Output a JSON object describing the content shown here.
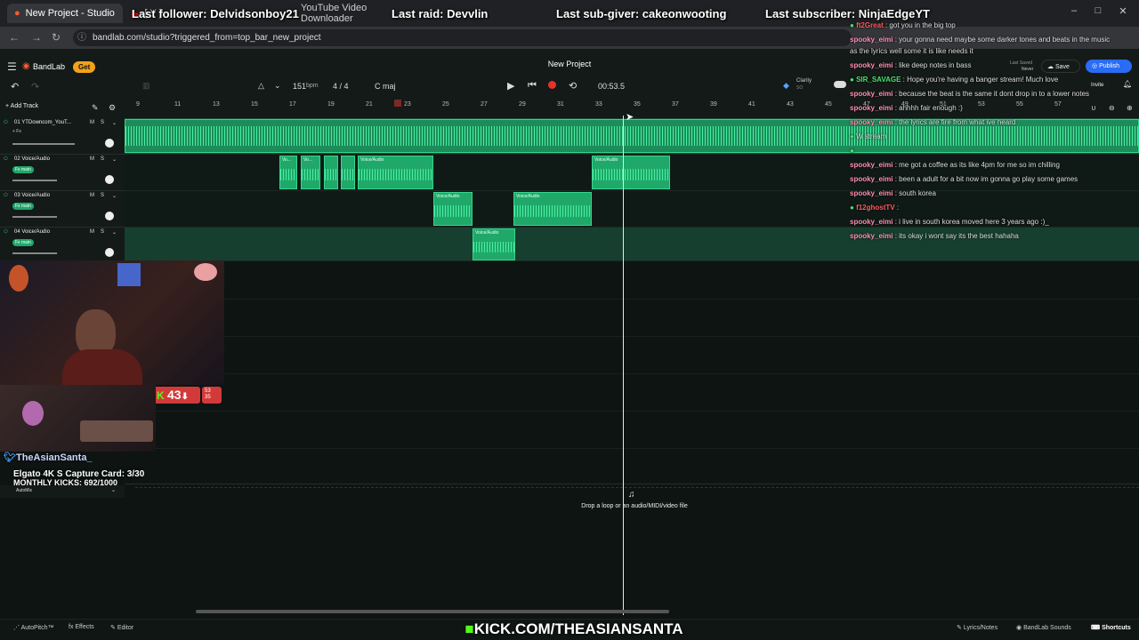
{
  "browser": {
    "tabs": [
      {
        "label": "New Project - Studio",
        "active": true
      },
      {
        "label": "[ Y ] "
      },
      {
        "label": "YouTube Video Downloader"
      }
    ],
    "url": "bandlab.com/studio?triggered_from=top_bar_new_project"
  },
  "overlay": {
    "last_follower": "Last follower: Delvidsonboy21",
    "last_raid": "Last raid: Devvlin",
    "last_subgiver": "Last sub-giver: cakeonwooting",
    "last_subscriber": "Last subscriber: NinjaEdgeYT",
    "kick_url": "KICK.COM/THEASIANSANTA",
    "streamer_name": "TheAsianSanta_",
    "giveaway": "Elgato 4K S Capture Card: 3/30",
    "monthly_kicks": "MONTHLY KICKS: 692/1000",
    "kick_count": "43",
    "kick_sub_counts": [
      "53",
      "35"
    ]
  },
  "bandlab": {
    "brand": "BandLab",
    "get_badge": "Get",
    "project_title": "New Project",
    "bpm_value": "151",
    "bpm_unit": "bpm",
    "time_signature": "4 / 4",
    "key": "C maj",
    "time": "00:53.5",
    "clarity_label": "Clarity",
    "clarity_sub": "SO",
    "last_saved_label": "Last Saved",
    "last_saved_value": "Never",
    "save_label": "Save",
    "publish_label": "Publish",
    "invite_label": "Invite",
    "add_track_label": "Add Track",
    "drop_hint": "Drop a loop or an audio/MIDI/video file",
    "ruler": [
      "9",
      "11",
      "13",
      "15",
      "17",
      "19",
      "21",
      "23",
      "25",
      "27",
      "29",
      "31",
      "33",
      "35",
      "37",
      "39",
      "41",
      "43",
      "45",
      "47",
      "49",
      "51",
      "53",
      "55",
      "57"
    ],
    "tracks": [
      {
        "name": "01  YTDowncom_YouT...",
        "fx": "+ Fx"
      },
      {
        "name": "02  Voice/Audio",
        "fx": "Fx main"
      },
      {
        "name": "03  Voice/Audio",
        "fx": "Fx main"
      },
      {
        "name": "04  Voice/Audio",
        "fx": "Fx main"
      },
      {
        "name": "10  Voice/Audio",
        "fx": ""
      }
    ],
    "automix_label": "AutoMix",
    "mute_label": "M",
    "solo_label": "S",
    "clip_label": "Voice/Audio",
    "clip_label_short": "Vo...",
    "footer": {
      "autopitch": "AutoPitch™",
      "effects": "Effects",
      "editor": "Editor",
      "lyrics": "Lyrics/Notes",
      "sounds": "BandLab Sounds",
      "shortcuts": "Shortcuts"
    }
  },
  "chat": [
    {
      "user": "ft2Great",
      "msg": "got you in the big top",
      "color": "r"
    },
    {
      "user": "spooky_eimi",
      "msg": "your gonna need maybe some darker tones and beats in the music",
      "color": ""
    },
    {
      "user": "",
      "msg": "as the lyrics well some it is like needs it",
      "color": ""
    },
    {
      "user": "spooky_eimi",
      "msg": "like deep notes in bass",
      "color": ""
    },
    {
      "user": "SIR_SAVAGE",
      "msg": "Hope you're having a banger stream! Much love",
      "color": "g"
    },
    {
      "user": "spooky_eimi",
      "msg": "because the beat is the same it dont drop in to a lower notes",
      "color": ""
    },
    {
      "user": "spooky_eimi",
      "msg": "ahhhh fair enough :)",
      "color": ""
    },
    {
      "user": "spooky_eimi",
      "msg": "the lyrics are fire from what ive heard",
      "color": ""
    },
    {
      "user": "",
      "msg": "W stream",
      "color": "p"
    },
    {
      "user": "",
      "msg": "",
      "color": "p"
    },
    {
      "user": "spooky_eimi",
      "msg": "me got a coffee as its like 4pm for me so im chilling",
      "color": ""
    },
    {
      "user": "spooky_eimi",
      "msg": "been a adult for a bit now im gonna go play some games",
      "color": ""
    },
    {
      "user": "spooky_eimi",
      "msg": "south korea",
      "color": ""
    },
    {
      "user": "f12ghostTV",
      "msg": "",
      "color": "r"
    },
    {
      "user": "spooky_eimi",
      "msg": "i live in south korea moved here 3 years ago :)_",
      "color": ""
    },
    {
      "user": "spooky_eimi",
      "msg": "its okay i wont say its the best hahaha",
      "color": ""
    }
  ],
  "colors": {
    "accent": "#1fa86a",
    "publish": "#2a6cf5",
    "kick": "#53fc18",
    "record": "#e5322d"
  }
}
